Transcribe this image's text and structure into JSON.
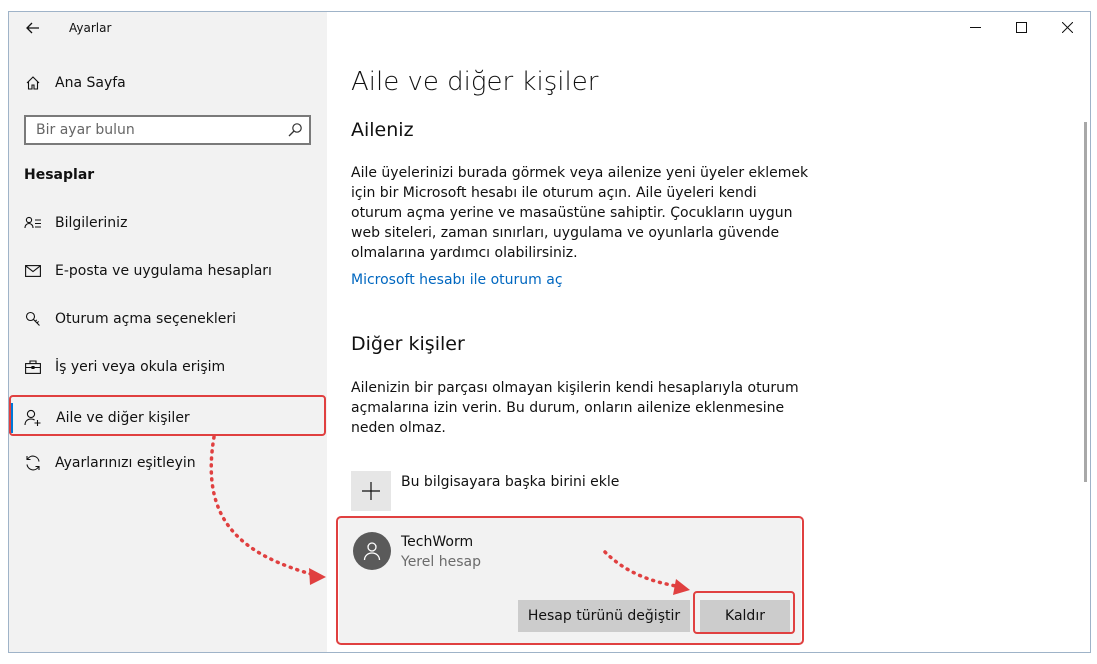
{
  "window": {
    "title": "Ayarlar",
    "controls": {
      "minimize": "minimize",
      "maximize": "maximize",
      "close": "close"
    }
  },
  "sidebar": {
    "home_label": "Ana Sayfa",
    "search_placeholder": "Bir ayar bulun",
    "section_title": "Hesaplar",
    "items": [
      {
        "label": "Bilgileriniz",
        "icon": "user-card-icon"
      },
      {
        "label": "E-posta ve uygulama hesapları",
        "icon": "mail-icon"
      },
      {
        "label": "Oturum açma seçenekleri",
        "icon": "key-icon"
      },
      {
        "label": "İş yeri veya okula erişim",
        "icon": "briefcase-icon"
      },
      {
        "label": "Aile ve diğer kişiler",
        "icon": "add-person-icon",
        "selected": true
      },
      {
        "label": "Ayarlarınızı eşitleyin",
        "icon": "sync-icon"
      }
    ]
  },
  "main": {
    "title": "Aile ve diğer kişiler",
    "family": {
      "heading": "Aileniz",
      "description": "Aile üyelerinizi burada görmek veya ailenize yeni üyeler eklemek için bir Microsoft hesabı ile oturum açın. Aile üyeleri kendi oturum açma yerine ve masaüstüne sahiptir. Çocukların uygun web siteleri, zaman sınırları, uygulama ve oyunlarla güvende olmalarına yardımcı olabilirsiniz.",
      "link": "Microsoft hesabı ile oturum aç"
    },
    "others": {
      "heading": "Diğer kişiler",
      "description": "Ailenizin bir parçası olmayan kişilerin kendi hesaplarıyla oturum açmalarına izin verin. Bu durum, onların ailenize eklenmesine neden olmaz.",
      "add_label": "Bu bilgisayara başka birini ekle",
      "user": {
        "name": "TechWorm",
        "type": "Yerel hesap",
        "change_button": "Hesap türünü değiştir",
        "remove_button": "Kaldır"
      }
    }
  },
  "colors": {
    "accent": "#0078d7",
    "link": "#0067c0",
    "annotation": "#e04040",
    "sidebar_bg": "#f2f2f2"
  }
}
